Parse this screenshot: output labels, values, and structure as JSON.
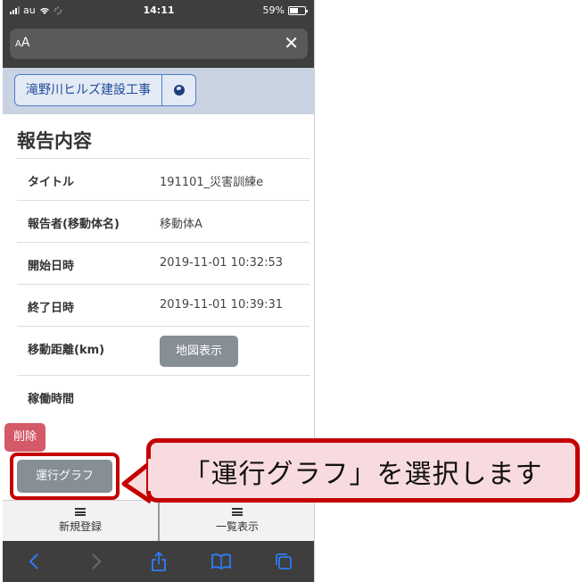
{
  "status_bar": {
    "carrier": "au",
    "time": "14:11",
    "battery": "59%",
    "battery_level": 0.59
  },
  "address_bar": {
    "text_size_label": "AA",
    "close_symbol": "✕"
  },
  "site": {
    "name": "滝野川ヒルズ建設工事",
    "globe_icon": "globe-icon"
  },
  "report": {
    "heading": "報告内容",
    "rows": [
      {
        "label": "タイトル",
        "value": "191101_災害訓練e"
      },
      {
        "label": "報告者(移動体名)",
        "value": "移動体A"
      },
      {
        "label": "開始日時",
        "value": "2019-11-01 10:32:53"
      },
      {
        "label": "終了日時",
        "value": "2019-11-01 10:39:31"
      },
      {
        "label": "移動距離(km)",
        "value": ""
      },
      {
        "label": "稼働時間",
        "value": ""
      }
    ],
    "map_button": "地図表示",
    "delete_button": "削除",
    "graph_button": "運行グラフ"
  },
  "app_nav": {
    "items": [
      {
        "label": "新規登録",
        "icon": "list-icon"
      },
      {
        "label": "一覧表示",
        "icon": "list-icon"
      }
    ]
  },
  "safari_toolbar": {
    "icons": [
      "back-icon",
      "forward-icon",
      "share-icon",
      "bookmarks-icon",
      "tabs-icon"
    ]
  },
  "callout": {
    "text": "「運行グラフ」を選択します"
  },
  "colors": {
    "highlight_red": "#c40000",
    "callout_bg": "#f8dbdf",
    "delete_red": "#d45a68",
    "gray_button": "#868e96",
    "site_header_bg": "#c9d3e2"
  }
}
